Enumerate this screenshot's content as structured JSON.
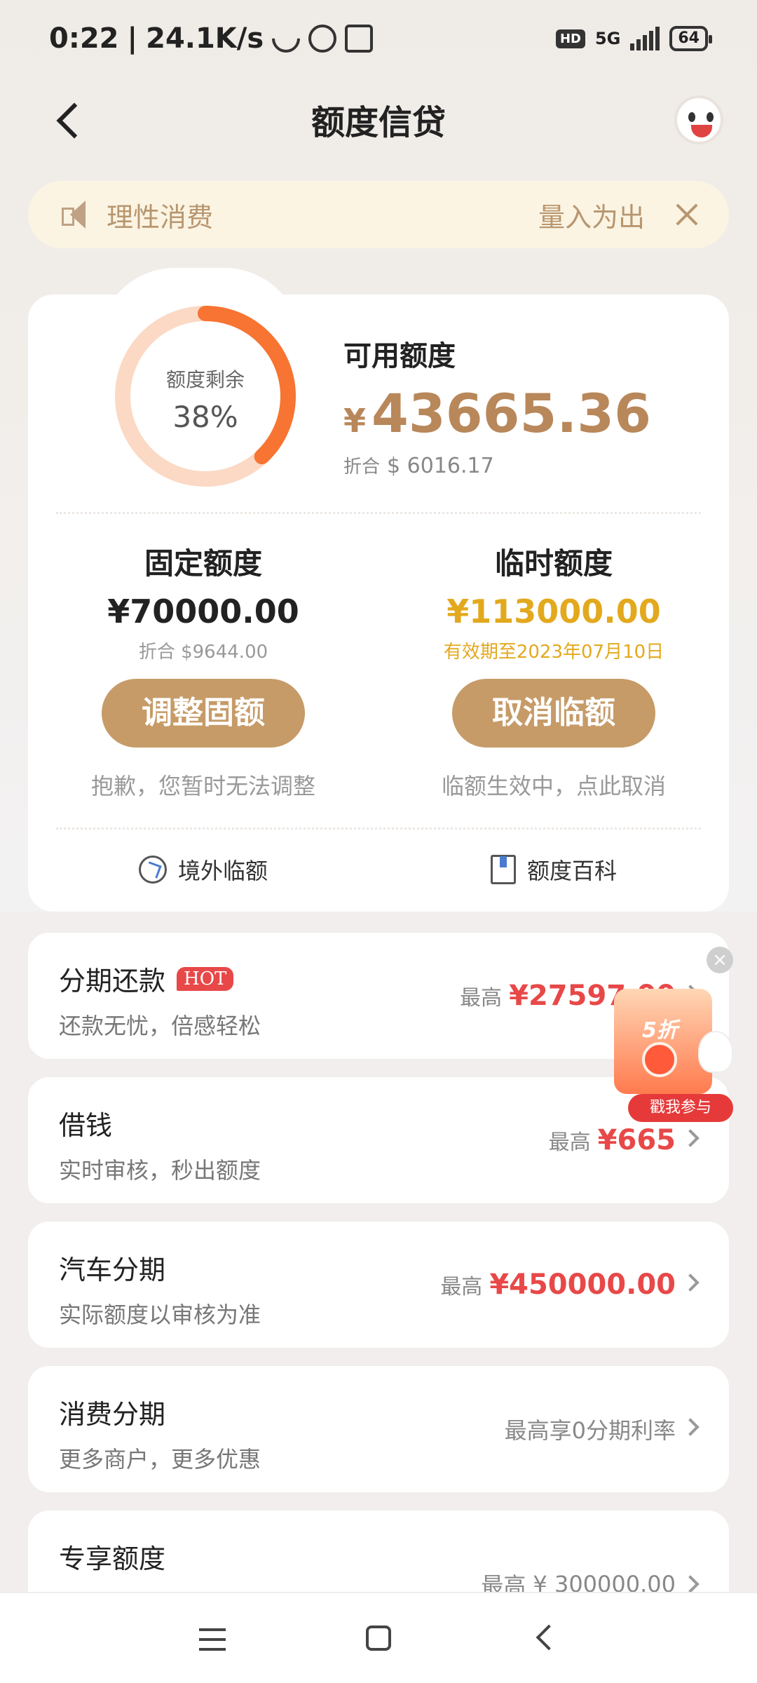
{
  "status": {
    "time": "0:22",
    "speed": "24.1K/s",
    "network": "5G",
    "hd": "HD",
    "battery": "64"
  },
  "header": {
    "title": "额度信贷"
  },
  "notice": {
    "text": "理性消费",
    "right": "量入为出"
  },
  "credit": {
    "ring_label": "额度剩余",
    "ring_percent": "38%",
    "ring_fraction": 0.38,
    "available_title": "可用额度",
    "currency": "¥",
    "available_amount": "43665.36",
    "converted_label": "折合",
    "converted_amount": "$ 6016.17",
    "fixed": {
      "title": "固定额度",
      "amount": "¥70000.00",
      "sub": "折合 $9644.00",
      "button": "调整固额",
      "note": "抱歉，您暂时无法调整"
    },
    "temp": {
      "title": "临时额度",
      "amount": "¥113000.00",
      "sub": "有效期至2023年07月10日",
      "button": "取消临额",
      "note": "临额生效中，点此取消"
    },
    "links": {
      "overseas": "境外临额",
      "wiki": "额度百科"
    }
  },
  "products": [
    {
      "title": "分期还款",
      "badge": "HOT",
      "sub": "还款无忧，倍感轻松",
      "label": "最高",
      "value": "¥27597.00"
    },
    {
      "title": "借钱",
      "sub": "实时审核，秒出额度",
      "label": "最高",
      "value": "¥665"
    },
    {
      "title": "汽车分期",
      "sub": "实际额度以审核为准",
      "label": "最高",
      "value": "¥450000.00"
    },
    {
      "title": "消费分期",
      "sub": "更多商户，更多优惠",
      "value": "最高享0分期利率"
    },
    {
      "title": "专享额度",
      "label": "最高",
      "value": "¥ 300000.00"
    }
  ],
  "promo": {
    "discount": "5折",
    "button": "戳我参与",
    "close": "×"
  },
  "colors": {
    "accent_gold": "#c69b68",
    "amount_gold": "#b8875a",
    "temp_yellow": "#e3a91e",
    "ring_orange": "#f77432",
    "ring_light": "#fbd9c5",
    "red": "#e84848"
  }
}
